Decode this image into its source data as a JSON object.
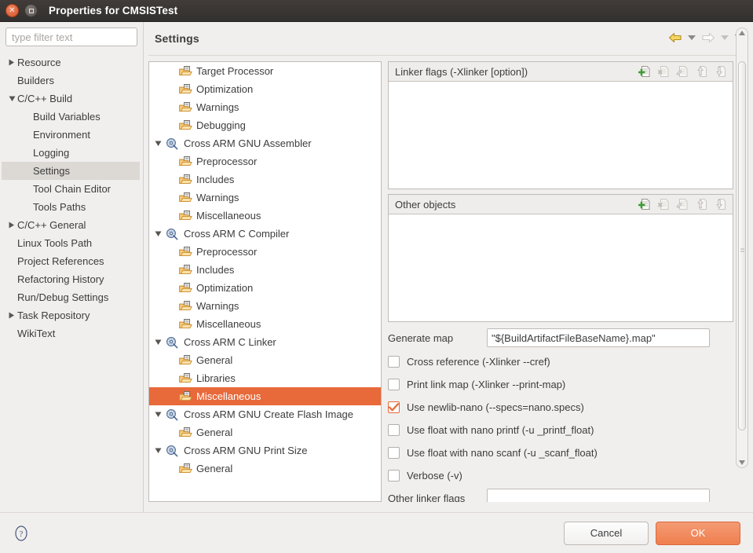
{
  "window": {
    "title": "Properties for CMSISTest",
    "close_icon": "close-icon",
    "maximize_icon": "maximize-icon"
  },
  "filter": {
    "placeholder": "type filter text",
    "value": "",
    "clear_icon": "clear-icon"
  },
  "sidebar": {
    "items": [
      {
        "label": "Resource",
        "arrow": "collapsed",
        "indent": 0,
        "selected": false
      },
      {
        "label": "Builders",
        "arrow": "none",
        "indent": 0,
        "selected": false
      },
      {
        "label": "C/C++ Build",
        "arrow": "expanded",
        "indent": 0,
        "selected": false
      },
      {
        "label": "Build Variables",
        "arrow": "none",
        "indent": 1,
        "selected": false
      },
      {
        "label": "Environment",
        "arrow": "none",
        "indent": 1,
        "selected": false
      },
      {
        "label": "Logging",
        "arrow": "none",
        "indent": 1,
        "selected": false
      },
      {
        "label": "Settings",
        "arrow": "none",
        "indent": 1,
        "selected": true
      },
      {
        "label": "Tool Chain Editor",
        "arrow": "none",
        "indent": 1,
        "selected": false
      },
      {
        "label": "Tools Paths",
        "arrow": "none",
        "indent": 1,
        "selected": false
      },
      {
        "label": "C/C++ General",
        "arrow": "collapsed",
        "indent": 0,
        "selected": false
      },
      {
        "label": "Linux Tools Path",
        "arrow": "none",
        "indent": 0,
        "selected": false
      },
      {
        "label": "Project References",
        "arrow": "none",
        "indent": 0,
        "selected": false
      },
      {
        "label": "Refactoring History",
        "arrow": "none",
        "indent": 0,
        "selected": false
      },
      {
        "label": "Run/Debug Settings",
        "arrow": "none",
        "indent": 0,
        "selected": false
      },
      {
        "label": "Task Repository",
        "arrow": "collapsed",
        "indent": 0,
        "selected": false
      },
      {
        "label": "WikiText",
        "arrow": "none",
        "indent": 0,
        "selected": false
      }
    ]
  },
  "header": {
    "title": "Settings",
    "nav": {
      "back_icon": "back-arrow-icon",
      "back_menu_icon": "chevron-down-icon",
      "forward_icon": "forward-arrow-icon",
      "forward_menu_icon": "chevron-down-icon",
      "menu_icon": "chevron-down-icon"
    }
  },
  "tooltree": {
    "items": [
      {
        "label": "Target Processor",
        "arrow": "none",
        "icon": "option-folder-icon",
        "indent": 1,
        "selected": false
      },
      {
        "label": "Optimization",
        "arrow": "none",
        "icon": "option-folder-icon",
        "indent": 1,
        "selected": false
      },
      {
        "label": "Warnings",
        "arrow": "none",
        "icon": "option-folder-icon",
        "indent": 1,
        "selected": false
      },
      {
        "label": "Debugging",
        "arrow": "none",
        "icon": "option-folder-icon",
        "indent": 1,
        "selected": false
      },
      {
        "label": "Cross ARM GNU Assembler",
        "arrow": "expanded",
        "icon": "tool-icon",
        "indent": 0,
        "selected": false
      },
      {
        "label": "Preprocessor",
        "arrow": "none",
        "icon": "option-folder-icon",
        "indent": 1,
        "selected": false
      },
      {
        "label": "Includes",
        "arrow": "none",
        "icon": "option-folder-icon",
        "indent": 1,
        "selected": false
      },
      {
        "label": "Warnings",
        "arrow": "none",
        "icon": "option-folder-icon",
        "indent": 1,
        "selected": false
      },
      {
        "label": "Miscellaneous",
        "arrow": "none",
        "icon": "option-folder-icon",
        "indent": 1,
        "selected": false
      },
      {
        "label": "Cross ARM C Compiler",
        "arrow": "expanded",
        "icon": "tool-icon",
        "indent": 0,
        "selected": false
      },
      {
        "label": "Preprocessor",
        "arrow": "none",
        "icon": "option-folder-icon",
        "indent": 1,
        "selected": false
      },
      {
        "label": "Includes",
        "arrow": "none",
        "icon": "option-folder-icon",
        "indent": 1,
        "selected": false
      },
      {
        "label": "Optimization",
        "arrow": "none",
        "icon": "option-folder-icon",
        "indent": 1,
        "selected": false
      },
      {
        "label": "Warnings",
        "arrow": "none",
        "icon": "option-folder-icon",
        "indent": 1,
        "selected": false
      },
      {
        "label": "Miscellaneous",
        "arrow": "none",
        "icon": "option-folder-icon",
        "indent": 1,
        "selected": false
      },
      {
        "label": "Cross ARM C Linker",
        "arrow": "expanded",
        "icon": "tool-icon",
        "indent": 0,
        "selected": false
      },
      {
        "label": "General",
        "arrow": "none",
        "icon": "option-folder-icon",
        "indent": 1,
        "selected": false
      },
      {
        "label": "Libraries",
        "arrow": "none",
        "icon": "option-folder-icon",
        "indent": 1,
        "selected": false
      },
      {
        "label": "Miscellaneous",
        "arrow": "none",
        "icon": "option-folder-icon",
        "indent": 1,
        "selected": true
      },
      {
        "label": "Cross ARM GNU Create Flash Image",
        "arrow": "expanded",
        "icon": "tool-icon",
        "indent": 0,
        "selected": false
      },
      {
        "label": "General",
        "arrow": "none",
        "icon": "option-folder-icon",
        "indent": 1,
        "selected": false
      },
      {
        "label": "Cross ARM GNU Print Size",
        "arrow": "expanded",
        "icon": "tool-icon",
        "indent": 0,
        "selected": false
      },
      {
        "label": "General",
        "arrow": "none",
        "icon": "option-folder-icon",
        "indent": 1,
        "selected": false
      }
    ]
  },
  "options": {
    "linker_flags": {
      "title": "Linker flags (-Xlinker [option])",
      "entries": [],
      "tools": [
        {
          "name": "add-icon",
          "enabled": true
        },
        {
          "name": "delete-icon",
          "enabled": false
        },
        {
          "name": "edit-icon",
          "enabled": false
        },
        {
          "name": "move-up-icon",
          "enabled": false
        },
        {
          "name": "move-down-icon",
          "enabled": false
        }
      ]
    },
    "other_objects": {
      "title": "Other objects",
      "entries": [],
      "tools": [
        {
          "name": "add-icon",
          "enabled": true
        },
        {
          "name": "delete-icon",
          "enabled": false
        },
        {
          "name": "edit-icon",
          "enabled": false
        },
        {
          "name": "move-up-icon",
          "enabled": false
        },
        {
          "name": "move-down-icon",
          "enabled": false
        }
      ]
    },
    "generate_map": {
      "label": "Generate map",
      "value": "\"${BuildArtifactFileBaseName}.map\"",
      "placeholder": ""
    },
    "checkboxes": [
      {
        "label": "Cross reference (-Xlinker --cref)",
        "checked": false
      },
      {
        "label": "Print link map (-Xlinker --print-map)",
        "checked": false
      },
      {
        "label": "Use newlib-nano (--specs=nano.specs)",
        "checked": true
      },
      {
        "label": "Use float with nano printf (-u _printf_float)",
        "checked": false
      },
      {
        "label": "Use float with nano scanf (-u _scanf_float)",
        "checked": false
      },
      {
        "label": "Verbose (-v)",
        "checked": false
      }
    ],
    "other_linker_flags": {
      "label": "Other linker flags",
      "value": "",
      "placeholder": ""
    }
  },
  "footer": {
    "help_icon": "help-icon",
    "cancel_label": "Cancel",
    "ok_label": "OK"
  },
  "colors": {
    "selection_orange": "#e8693a",
    "ok_button": "#ef7f4e",
    "sidebar_selection": "#dcd8d4",
    "titlebar": "#3a3633"
  }
}
